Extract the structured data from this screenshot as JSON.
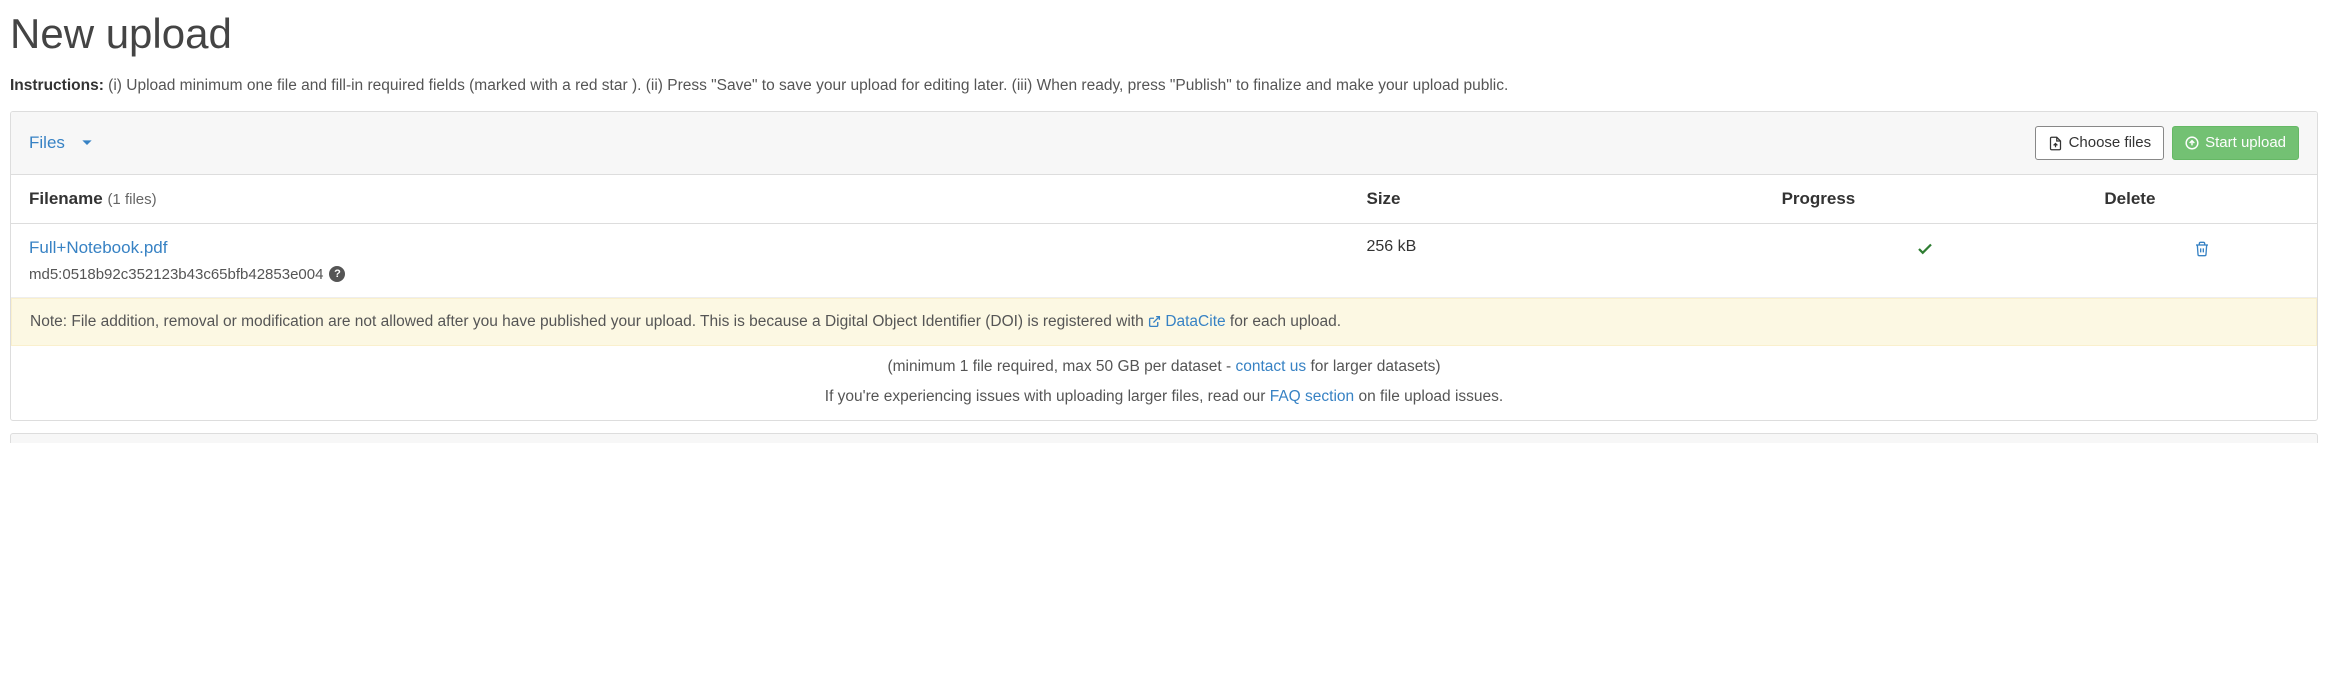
{
  "page_title": "New upload",
  "instructions_label": "Instructions:",
  "instructions_text": " (i) Upload minimum one file and fill-in required fields (marked with a red star ). (ii) Press \"Save\" to save your upload for editing later. (iii) When ready, press \"Publish\" to finalize and make your upload public.",
  "panel": {
    "title": "Files",
    "choose_files_label": "Choose files",
    "start_upload_label": "Start upload"
  },
  "table": {
    "headers": {
      "filename": "Filename",
      "count_text": "(1 files)",
      "size": "Size",
      "progress": "Progress",
      "delete": "Delete"
    },
    "rows": [
      {
        "filename": "Full+Notebook.pdf",
        "md5": "md5:0518b92c352123b43c65bfb42853e004",
        "size": "256 kB"
      }
    ]
  },
  "note": {
    "prefix": "Note: File addition, removal or modification are not allowed after you have published your upload. This is because a Digital Object Identifier (DOI) is registered with ",
    "link_text": "DataCite",
    "suffix": " for each upload."
  },
  "footer_min": {
    "prefix": "(minimum 1 file required, max 50 GB per dataset - ",
    "link": "contact us",
    "suffix": " for larger datasets)"
  },
  "footer_faq": {
    "prefix": "If you're experiencing issues with uploading larger files, read our ",
    "link": "FAQ section",
    "suffix": " on file upload issues."
  }
}
